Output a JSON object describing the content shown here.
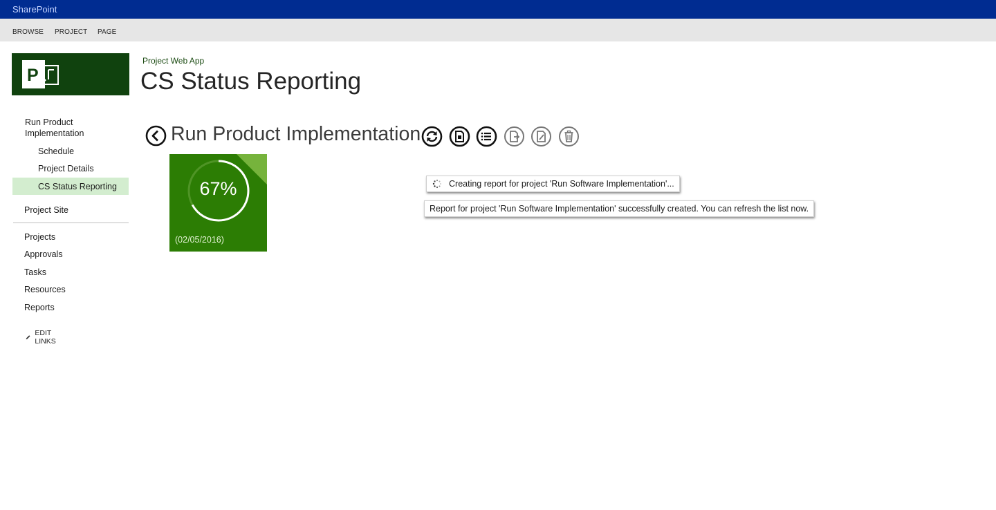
{
  "suite_bar": {
    "brand": "SharePoint"
  },
  "ribbon": {
    "tabs": [
      "BROWSE",
      "PROJECT",
      "PAGE"
    ]
  },
  "logo": {
    "icon": "project-logo-icon",
    "color": "#10420e"
  },
  "site": {
    "suite": "Project Web App",
    "title": "CS Status Reporting"
  },
  "nav": {
    "project": "Run Product Implementation",
    "sub_items": [
      "Schedule",
      "Project Details",
      "CS Status Reporting"
    ],
    "selected": "CS Status Reporting",
    "project_site": "Project Site",
    "main_items": [
      "Projects",
      "Approvals",
      "Tasks",
      "Resources",
      "Reports"
    ],
    "edit_links": "EDIT LINKS"
  },
  "page": {
    "heading": "Run Product Implementation"
  },
  "toolbar": {
    "icons": [
      "refresh-icon",
      "new-report-icon",
      "list-icon",
      "export-icon",
      "edit-report-icon",
      "delete-icon"
    ]
  },
  "status_tile": {
    "percent_label": "67%",
    "progress": 0.67,
    "date": "(02/05/2016)",
    "color": "#2c7d04"
  },
  "notifications": {
    "creating": "Creating report for project 'Run Software Implementation'...",
    "created": "Report for project 'Run Software Implementation' successfully created. You can refresh the list now."
  },
  "colors": {
    "suite_bar": "#002c91",
    "selected_nav": "#d3edcf",
    "accent_green": "#10420e"
  }
}
